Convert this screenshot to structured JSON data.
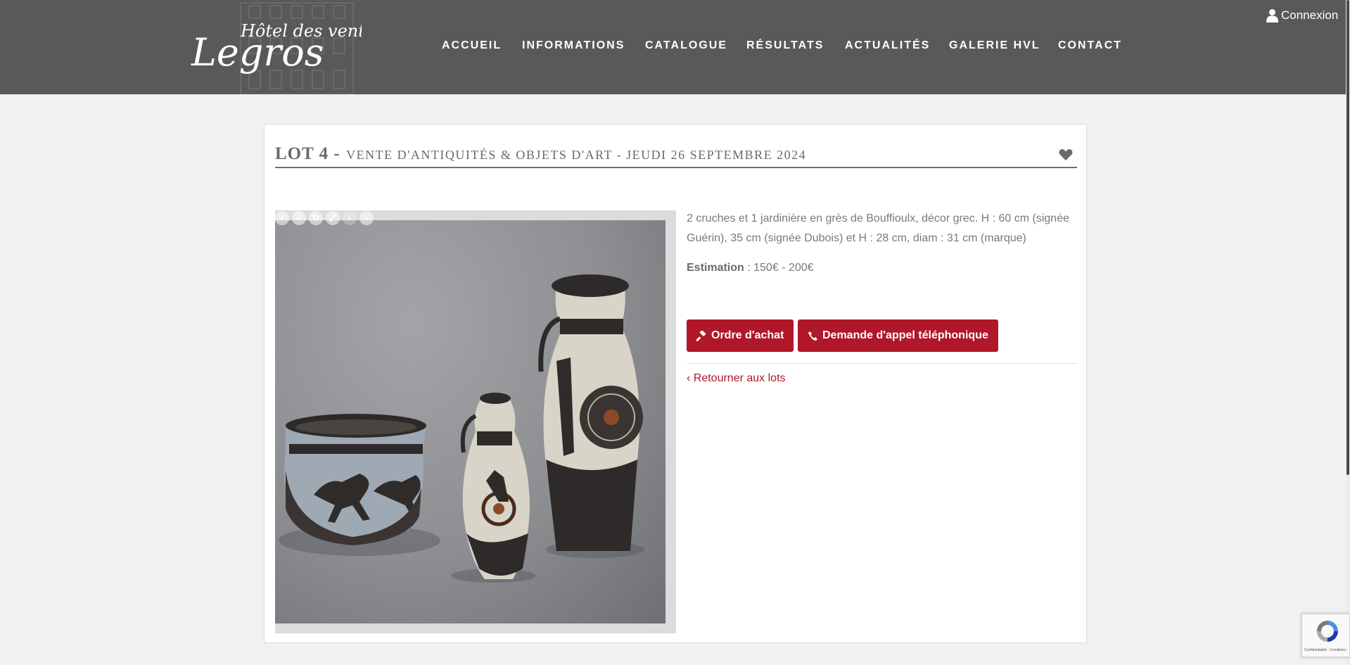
{
  "header": {
    "logo_line1": "Hôtel des ventes",
    "logo_line2": "Legros",
    "nav": [
      "ACCUEIL",
      "INFORMATIONS",
      "CATALOGUE",
      "RÉSULTATS",
      "ACTUALITÉS",
      "GALERIE HVL",
      "CONTACT"
    ],
    "login_label": "Connexion",
    "login_icon": "user-icon"
  },
  "lot": {
    "number": "LOT 4 -",
    "sale": "VENTE D'ANTIQUITÉS & OBJETS D'ART - JEUDI 26 SEPTEMBRE 2024",
    "favorite_icon": "heart-icon",
    "description": "2 cruches et 1 jardinière en grès de Bouffioulx, décor grec. H : 60 cm (signée Guérin), 35 cm (signée Dubois) et H : 28 cm, diam : 31 cm (marque)",
    "estimation_label": "Estimation",
    "estimation_value": " : 150€ - 200€",
    "order_button": "Ordre d'achat",
    "order_icon": "gavel-icon",
    "phone_button": "Demande d'appel téléphonique",
    "phone_icon": "phone-icon",
    "back_link": "‹ Retourner aux lots"
  },
  "viewer": {
    "tools": [
      "zoom-in",
      "zoom-out",
      "reset",
      "fullscreen",
      "previous",
      "next"
    ]
  },
  "recaptcha": {
    "legal": "Confidentialité - Conditions"
  },
  "colors": {
    "header": "#58595b",
    "accent": "#b01728",
    "background": "#f1f1f1"
  }
}
